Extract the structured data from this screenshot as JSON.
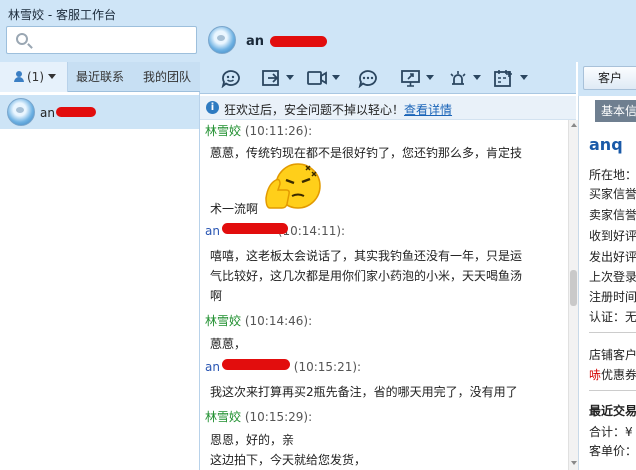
{
  "window": {
    "title": "林雪姣 - 客服工作台"
  },
  "search": {
    "placeholder": ""
  },
  "chat_header": {
    "contact_name": "an"
  },
  "left_tabs": [
    {
      "label": "(1)",
      "icon": "user-icon"
    },
    {
      "label": "最近联系"
    },
    {
      "label": "我的团队"
    }
  ],
  "contacts": [
    {
      "name": "an"
    }
  ],
  "toolbar": {
    "icons": [
      "emoji-icon",
      "transfer-icon",
      "video-icon",
      "quick-reply-icon",
      "screen-share-icon",
      "alarm-icon",
      "calendar-icon"
    ]
  },
  "notice": {
    "text": "狂欢过后，安全问题不掉以轻心！",
    "link": "查看详情"
  },
  "messages": [
    {
      "sender": "林雪姣",
      "time": "(10:11:26):",
      "lines": [
        "蒽蒽，传统钓现在都不是很好钓了，您还钓那么多，肯定技",
        "术一流啊"
      ],
      "emoji": "thumbs-up-emoji"
    },
    {
      "sender": "an",
      "time": "(10:14:11):",
      "lines": [
        "嘻嘻，这老板太会说话了，其实我钓鱼还没有一年，只是运",
        "气比较好，这几次都是用你们家小药泡的小米，天天喝鱼汤",
        "啊"
      ]
    },
    {
      "sender": "林雪姣",
      "time": "(10:14:46):",
      "lines": [
        "蒽蒽，"
      ]
    },
    {
      "sender": "an",
      "time": "(10:15:21):",
      "lines": [
        "我这次来打算再买2瓶先备注，省的哪天用完了，没有用了"
      ]
    },
    {
      "sender": "林雪姣",
      "time": "(10:15:29):",
      "lines": [
        "恩恩，好的，亲",
        "这边拍下，今天就给您发货，"
      ]
    }
  ],
  "right_panel": {
    "customer_button": "客户",
    "tab": "基本信",
    "name": "anq",
    "fields": [
      "所在地：",
      "买家信誉",
      "卖家信誉",
      "收到好评",
      "发出好评",
      "上次登录",
      "注册时间",
      "认证：无"
    ],
    "shop_customer": "店铺客户",
    "coupon": "优惠券",
    "coupon_prefix": "哧",
    "recent_trade": "最近交易",
    "total": "合计：¥",
    "unit_price": "客单价："
  }
}
